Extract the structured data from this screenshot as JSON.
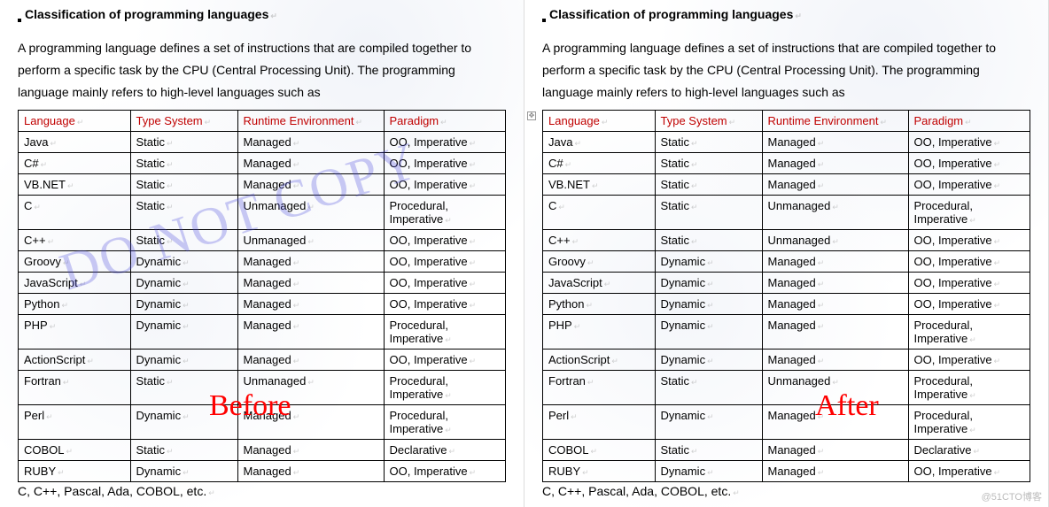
{
  "heading": "Classification of programming languages",
  "paragraph": "A programming language defines a set of instructions that are compiled together to perform a specific task by the CPU (Central Processing Unit). The programming language mainly refers to high-level languages such as",
  "footer": "C, C++, Pascal, Ada, COBOL, etc.",
  "table": {
    "headers": [
      "Language",
      "Type System",
      "Runtime Environment",
      "Paradigm"
    ],
    "rows": [
      [
        "Java",
        "Static",
        "Managed",
        "OO, Imperative"
      ],
      [
        "C#",
        "Static",
        "Managed",
        "OO, Imperative"
      ],
      [
        "VB.NET",
        "Static",
        "Managed",
        "OO, Imperative"
      ],
      [
        "C",
        "Static",
        "Unmanaged",
        "Procedural, Imperative"
      ],
      [
        "C++",
        "Static",
        "Unmanaged",
        "OO, Imperative"
      ],
      [
        "Groovy",
        "Dynamic",
        "Managed",
        "OO, Imperative"
      ],
      [
        "JavaScript",
        "Dynamic",
        "Managed",
        "OO, Imperative"
      ],
      [
        "Python",
        "Dynamic",
        "Managed",
        "OO, Imperative"
      ],
      [
        "PHP",
        "Dynamic",
        "Managed",
        "Procedural, Imperative"
      ],
      [
        "ActionScript",
        "Dynamic",
        "Managed",
        "OO, Imperative"
      ],
      [
        "Fortran",
        "Static",
        "Unmanaged",
        "Procedural, Imperative"
      ],
      [
        "Perl",
        "Dynamic",
        "Managed",
        "Procedural, Imperative"
      ],
      [
        "COBOL",
        "Static",
        "Managed",
        "Declarative"
      ],
      [
        "RUBY",
        "Dynamic",
        "Managed",
        "OO, Imperative"
      ]
    ]
  },
  "labels": {
    "before": "Before",
    "after": "After"
  },
  "watermark": "DO NOT COPY",
  "credit": "@51CTO博客"
}
